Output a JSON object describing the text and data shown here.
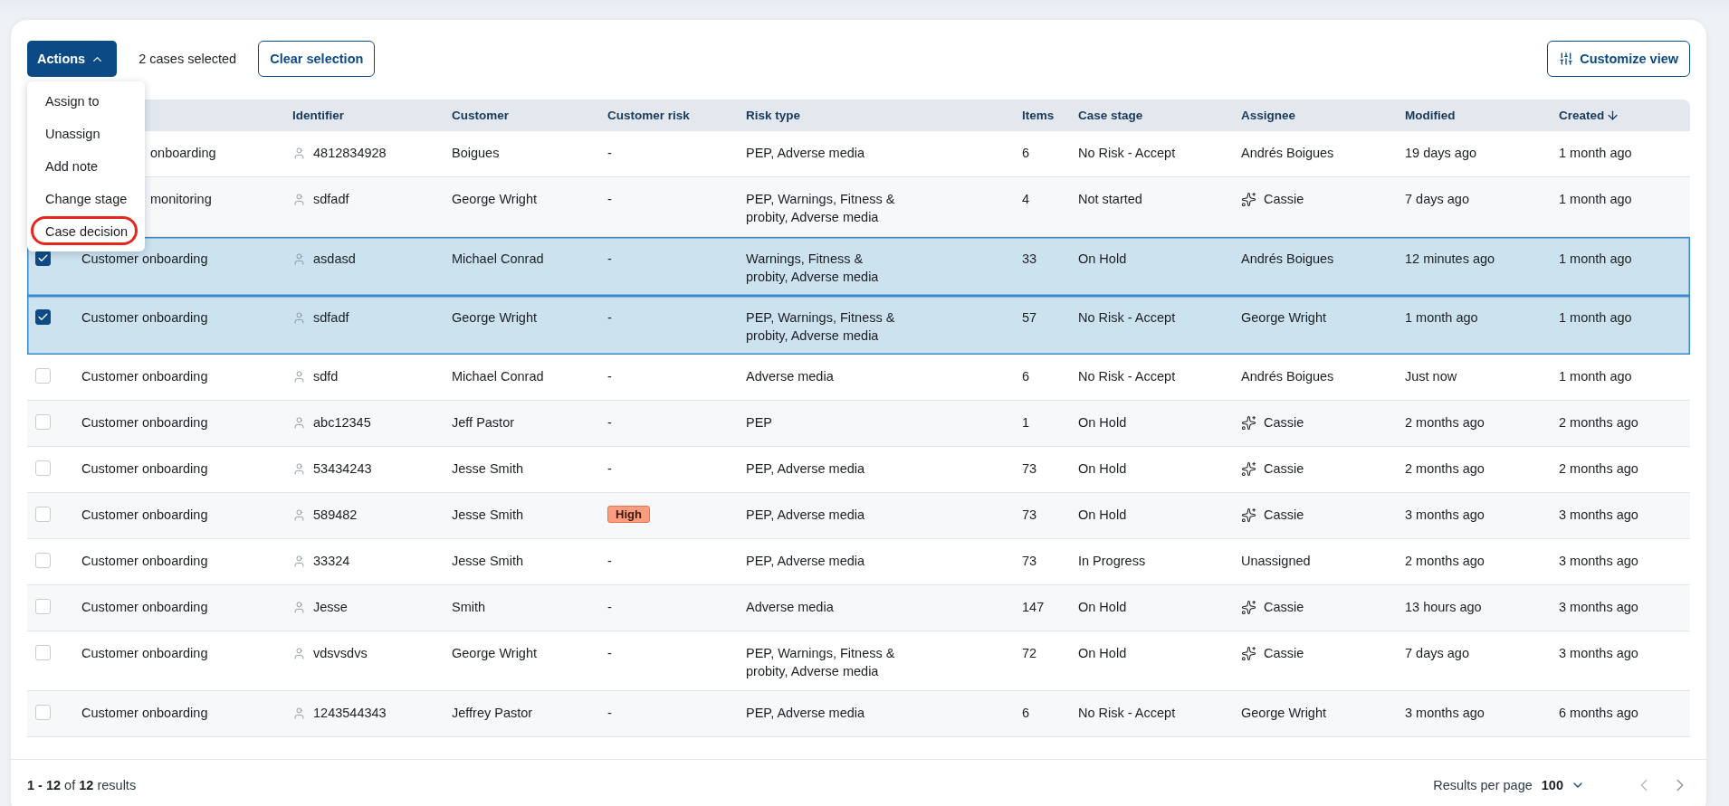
{
  "toolbar": {
    "actions_button": {
      "label": "Actions",
      "expanded": true
    },
    "selection_count": "2 cases selected",
    "clear_button": "Clear selection",
    "customize_button": "Customize view"
  },
  "actions_menu": [
    {
      "label": "Assign to",
      "highlighted": false
    },
    {
      "label": "Unassign",
      "highlighted": false
    },
    {
      "label": "Add note",
      "highlighted": false
    },
    {
      "label": "Change stage",
      "highlighted": false
    },
    {
      "label": "Case decision",
      "highlighted": true
    }
  ],
  "table": {
    "columns": [
      {
        "label": "Identifier",
        "sorted": false
      },
      {
        "label": "Customer",
        "sorted": false
      },
      {
        "label": "Customer risk",
        "sorted": false
      },
      {
        "label": "Risk type",
        "sorted": false
      },
      {
        "label": "Items",
        "sorted": false
      },
      {
        "label": "Case stage",
        "sorted": false
      },
      {
        "label": "Assignee",
        "sorted": false
      },
      {
        "label": "Modified",
        "sorted": false
      },
      {
        "label": "Created",
        "sorted": true
      }
    ],
    "rows": [
      {
        "type": "onboarding",
        "identifier": "4812834928",
        "customer": "Boigues",
        "customer_risk": {
          "text": "-",
          "kind": "plain"
        },
        "risk_type": "PEP, Adverse media",
        "items": "6",
        "case_stage": "No Risk - Accept",
        "assignee": {
          "name": "Andrés Boigues",
          "kind": "person"
        },
        "modified": "19 days ago",
        "created": "1 month ago"
      },
      {
        "type": "monitoring",
        "identifier": "sdfadf",
        "customer": "George Wright",
        "customer_risk": {
          "text": "-",
          "kind": "plain"
        },
        "risk_type": "PEP, Warnings, Fitness & probity, Adverse media",
        "items": "4",
        "case_stage": "Not started",
        "assignee": {
          "name": "Cassie",
          "kind": "ai"
        },
        "modified": "7 days ago",
        "created": "1 month ago"
      },
      {
        "selected": true,
        "type": "Customer onboarding",
        "identifier": "asdasd",
        "customer": "Michael Conrad",
        "customer_risk": {
          "text": "-",
          "kind": "plain"
        },
        "risk_type": "Warnings, Fitness & probity, Adverse media",
        "items": "33",
        "case_stage": "On Hold",
        "assignee": {
          "name": "Andrés Boigues",
          "kind": "person"
        },
        "modified": "12 minutes ago",
        "created": "1 month ago"
      },
      {
        "selected": true,
        "type": "Customer onboarding",
        "identifier": "sdfadf",
        "customer": "George Wright",
        "customer_risk": {
          "text": "-",
          "kind": "plain"
        },
        "risk_type": "PEP, Warnings, Fitness & probity, Adverse media",
        "items": "57",
        "case_stage": "No Risk - Accept",
        "assignee": {
          "name": "George Wright",
          "kind": "person"
        },
        "modified": "1 month ago",
        "created": "1 month ago"
      },
      {
        "selected": false,
        "type": "Customer onboarding",
        "identifier": "sdfd",
        "customer": "Michael Conrad",
        "customer_risk": {
          "text": "-",
          "kind": "plain"
        },
        "risk_type": "Adverse media",
        "items": "6",
        "case_stage": "No Risk - Accept",
        "assignee": {
          "name": "Andrés Boigues",
          "kind": "person"
        },
        "modified": "Just now",
        "created": "1 month ago"
      },
      {
        "selected": false,
        "type": "Customer onboarding",
        "identifier": "abc12345",
        "customer": "Jeff Pastor",
        "customer_risk": {
          "text": "-",
          "kind": "plain"
        },
        "risk_type": "PEP",
        "items": "1",
        "case_stage": "On Hold",
        "assignee": {
          "name": "Cassie",
          "kind": "ai"
        },
        "modified": "2 months ago",
        "created": "2 months ago"
      },
      {
        "selected": false,
        "type": "Customer onboarding",
        "identifier": "53434243",
        "customer": "Jesse Smith",
        "customer_risk": {
          "text": "-",
          "kind": "plain"
        },
        "risk_type": "PEP, Adverse media",
        "items": "73",
        "case_stage": "On Hold",
        "assignee": {
          "name": "Cassie",
          "kind": "ai"
        },
        "modified": "2 months ago",
        "created": "2 months ago"
      },
      {
        "selected": false,
        "type": "Customer onboarding",
        "identifier": "589482",
        "customer": "Jesse Smith",
        "customer_risk": {
          "text": "High",
          "kind": "badge"
        },
        "risk_type": "PEP, Adverse media",
        "items": "73",
        "case_stage": "On Hold",
        "assignee": {
          "name": "Cassie",
          "kind": "ai"
        },
        "modified": "3 months ago",
        "created": "3 months ago"
      },
      {
        "selected": false,
        "type": "Customer onboarding",
        "identifier": "33324",
        "customer": "Jesse Smith",
        "customer_risk": {
          "text": "-",
          "kind": "plain"
        },
        "risk_type": "PEP, Adverse media",
        "items": "73",
        "case_stage": "In Progress",
        "assignee": {
          "name": "Unassigned",
          "kind": "person"
        },
        "modified": "2 months ago",
        "created": "3 months ago"
      },
      {
        "selected": false,
        "type": "Customer onboarding",
        "identifier": "Jesse",
        "customer": "Smith",
        "customer_risk": {
          "text": "-",
          "kind": "plain"
        },
        "risk_type": "Adverse media",
        "items": "147",
        "case_stage": "On Hold",
        "assignee": {
          "name": "Cassie",
          "kind": "ai"
        },
        "modified": "13 hours ago",
        "created": "3 months ago"
      },
      {
        "selected": false,
        "type": "Customer onboarding",
        "identifier": "vdsvsdvs",
        "customer": "George Wright",
        "customer_risk": {
          "text": "-",
          "kind": "plain"
        },
        "risk_type": "PEP, Warnings, Fitness & probity, Adverse media",
        "items": "72",
        "case_stage": "On Hold",
        "assignee": {
          "name": "Cassie",
          "kind": "ai"
        },
        "modified": "7 days ago",
        "created": "3 months ago"
      },
      {
        "selected": false,
        "type": "Customer onboarding",
        "identifier": "1243544343",
        "customer": "Jeffrey Pastor",
        "customer_risk": {
          "text": "-",
          "kind": "plain"
        },
        "risk_type": "PEP, Adverse media",
        "items": "6",
        "case_stage": "No Risk - Accept",
        "assignee": {
          "name": "George Wright",
          "kind": "person"
        },
        "modified": "3 months ago",
        "created": "6 months ago"
      }
    ]
  },
  "footer": {
    "summary": "**1 - 12** of **12** results",
    "per_page_label": "Results per page",
    "per_page_value": "100",
    "prev_disabled": true,
    "next_disabled": false
  }
}
